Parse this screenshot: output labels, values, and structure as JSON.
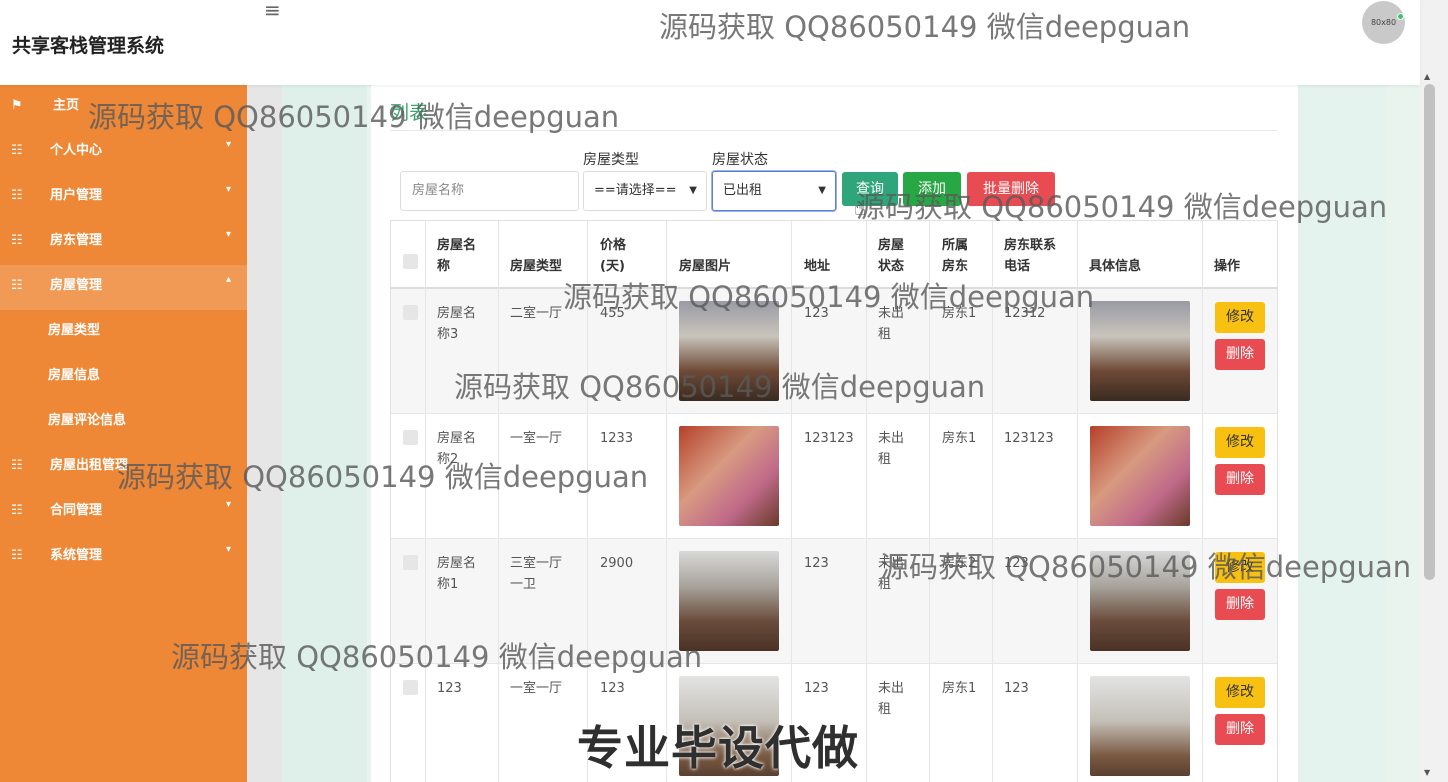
{
  "app": {
    "title": "共享客栈管理系统",
    "menu_icon": "hamburger-icon",
    "avatar_text": "80x80"
  },
  "sidebar": {
    "items": [
      {
        "label": "主页",
        "icon": "flag-icon"
      },
      {
        "label": "个人中心",
        "icon": "grid-icon"
      },
      {
        "label": "用户管理",
        "icon": "grid-icon"
      },
      {
        "label": "房东管理",
        "icon": "grid-icon"
      },
      {
        "label": "房屋管理",
        "icon": "grid-icon"
      },
      {
        "label": "房屋出租管理",
        "icon": "grid-icon"
      },
      {
        "label": "合同管理",
        "icon": "grid-icon"
      },
      {
        "label": "系统管理",
        "icon": "grid-icon"
      }
    ],
    "subitems": [
      {
        "label": "房屋类型"
      },
      {
        "label": "房屋信息"
      },
      {
        "label": "房屋评论信息"
      }
    ]
  },
  "breadcrumb": "列表",
  "filters": {
    "name_placeholder": "房屋名称",
    "type_label": "房屋类型",
    "type_value": "==请选择==",
    "status_label": "房屋状态",
    "status_value": "已出租"
  },
  "buttons": {
    "query": "查询",
    "add": "添加",
    "batch_delete": "批量删除",
    "edit": "修改",
    "delete": "删除"
  },
  "table": {
    "headers": [
      "房屋名称",
      "房屋类型",
      "价格(天)",
      "房屋图片",
      "地址",
      "房屋状态",
      "所属房东",
      "房东联系电话",
      "具体信息",
      "操作"
    ],
    "header_display": {
      "name": [
        "房屋名",
        "称"
      ],
      "price": [
        "价格",
        "(天)"
      ],
      "status": [
        "房屋",
        "状态"
      ],
      "landlord": [
        "所属",
        "房东"
      ],
      "phone": [
        "房东联系",
        "电话"
      ]
    },
    "rows": [
      {
        "name": [
          "房屋名",
          "称3"
        ],
        "type": [
          "二室一厅"
        ],
        "price": "455",
        "address": "123",
        "status": [
          "未出",
          "租"
        ],
        "landlord": "房东1",
        "phone": "12312"
      },
      {
        "name": [
          "房屋名",
          "称2"
        ],
        "type": [
          "一室一厅"
        ],
        "price": "1233",
        "address": "123123",
        "status": [
          "未出",
          "租"
        ],
        "landlord": "房东1",
        "phone": "123123"
      },
      {
        "name": [
          "房屋名",
          "称1"
        ],
        "type": [
          "三室一厅",
          "一卫"
        ],
        "price": "2900",
        "address": "123",
        "status": [
          "未出",
          "租"
        ],
        "landlord": "房东2",
        "phone": "123"
      },
      {
        "name": [
          "123"
        ],
        "type": [
          "一室一厅"
        ],
        "price": "123",
        "address": "123",
        "status": [
          "未出",
          "租"
        ],
        "landlord": "房东1",
        "phone": "123"
      }
    ]
  },
  "watermarks": {
    "text": "源码获取 QQ86050149 微信deepguan",
    "banner": "专业毕设代做"
  }
}
